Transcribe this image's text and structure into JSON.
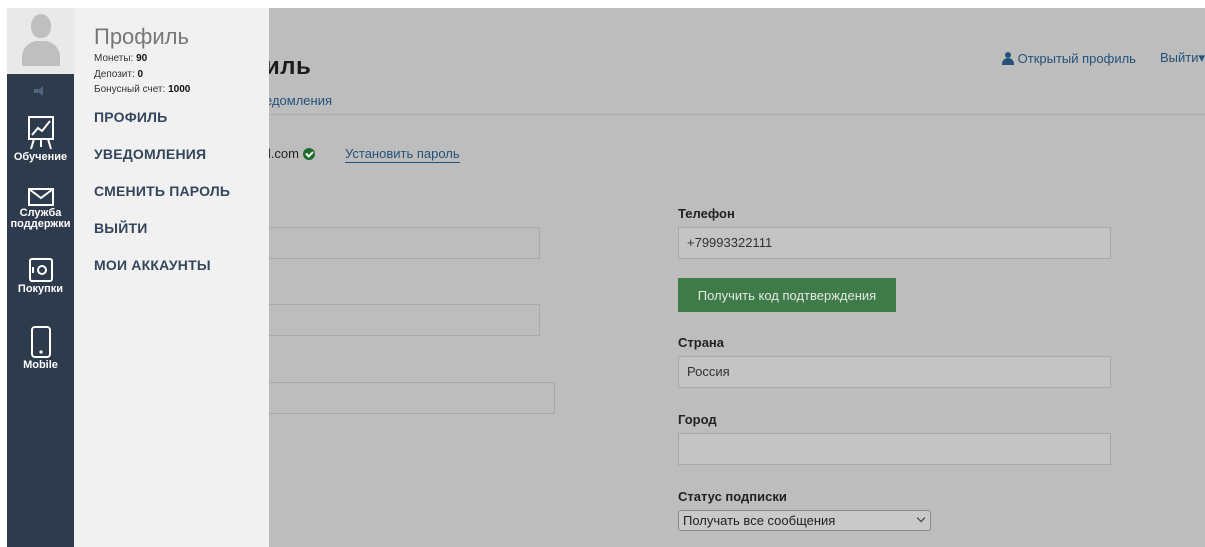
{
  "main": {
    "title_partial": "иль",
    "tab_partial": "едомления",
    "email_partial": "il.com",
    "set_password_link": "Установить пароль",
    "top_links": {
      "open_profile": "Открытый профиль",
      "logout": "Выйти"
    },
    "phone": {
      "label": "Телефон",
      "value": "+79993322111"
    },
    "get_code_button": "Получить код подтверждения",
    "country": {
      "label": "Страна",
      "value": "Россия"
    },
    "city": {
      "label": "Город",
      "value": ""
    },
    "subscription": {
      "label": "Статус подписки",
      "selected": "Получать все сообщения"
    }
  },
  "leftnav": {
    "items": [
      {
        "label": "Обучение",
        "icon": "chart-icon"
      },
      {
        "label": "Служба поддержки",
        "icon": "envelope-icon"
      },
      {
        "label": "Покупки",
        "icon": "safe-icon"
      },
      {
        "label": "Mobile",
        "icon": "mobile-icon"
      }
    ]
  },
  "panel": {
    "title": "Профиль",
    "coins_label": "Монеты:",
    "coins_value": "90",
    "deposit_label": "Депозит:",
    "deposit_value": "0",
    "bonus_label": "Бонусный счет:",
    "bonus_value": "1000",
    "menu": [
      "ПРОФИЛЬ",
      "УВЕДОМЛЕНИЯ",
      "СМЕНИТЬ ПАРОЛЬ",
      "ВЫЙТИ",
      "МОИ АККАУНТЫ"
    ]
  },
  "colors": {
    "nav_bg": "#2d3b4d",
    "panel_bg": "#f1f1f1",
    "overlay": "#bdbdbd",
    "link": "#24527a",
    "button_green": "#3f7a49"
  }
}
